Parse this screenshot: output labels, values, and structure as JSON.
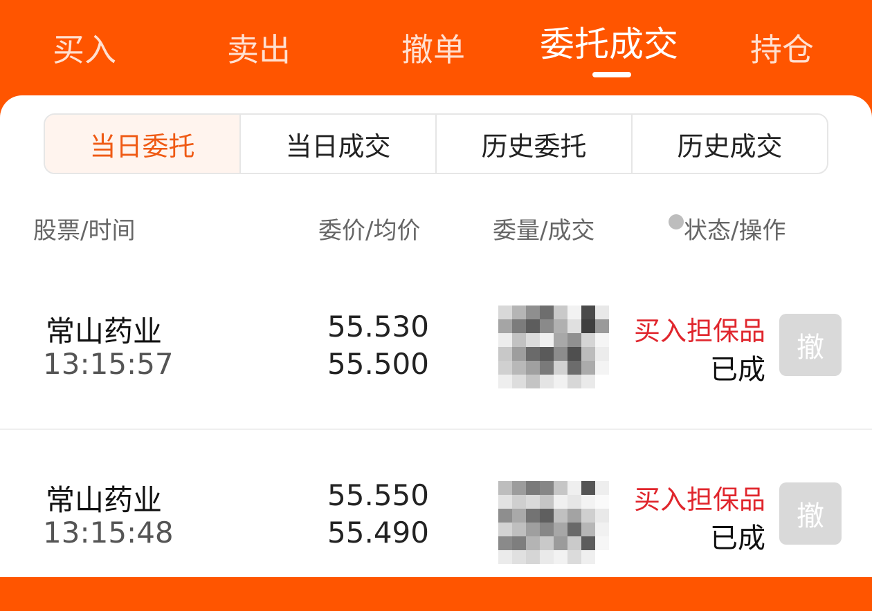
{
  "top_tabs": [
    {
      "label": "买入",
      "active": false
    },
    {
      "label": "卖出",
      "active": false
    },
    {
      "label": "撤单",
      "active": false
    },
    {
      "label": "委托成交",
      "active": true
    },
    {
      "label": "持仓",
      "active": false
    }
  ],
  "segments": [
    {
      "label": "当日委托",
      "active": true
    },
    {
      "label": "当日成交",
      "active": false
    },
    {
      "label": "历史委托",
      "active": false
    },
    {
      "label": "历史成交",
      "active": false
    }
  ],
  "columns": {
    "stock_time": "股票/时间",
    "price_avg": "委价/均价",
    "qty_filled": "委量/成交",
    "status_action": "状态/操作"
  },
  "orders": [
    {
      "stock": "常山药业",
      "time": "13:15:57",
      "order_price": "55.530",
      "avg_price": "55.500",
      "type": "买入担保品",
      "status": "已成",
      "action": "撤"
    },
    {
      "stock": "常山药业",
      "time": "13:15:48",
      "order_price": "55.550",
      "avg_price": "55.490",
      "type": "买入担保品",
      "status": "已成",
      "action": "撤"
    }
  ],
  "colors": {
    "brand_orange": "#ff5500",
    "active_segment_text": "#ef5a14",
    "order_type_red": "#e0262d",
    "disabled_button": "#d9d9d9"
  }
}
